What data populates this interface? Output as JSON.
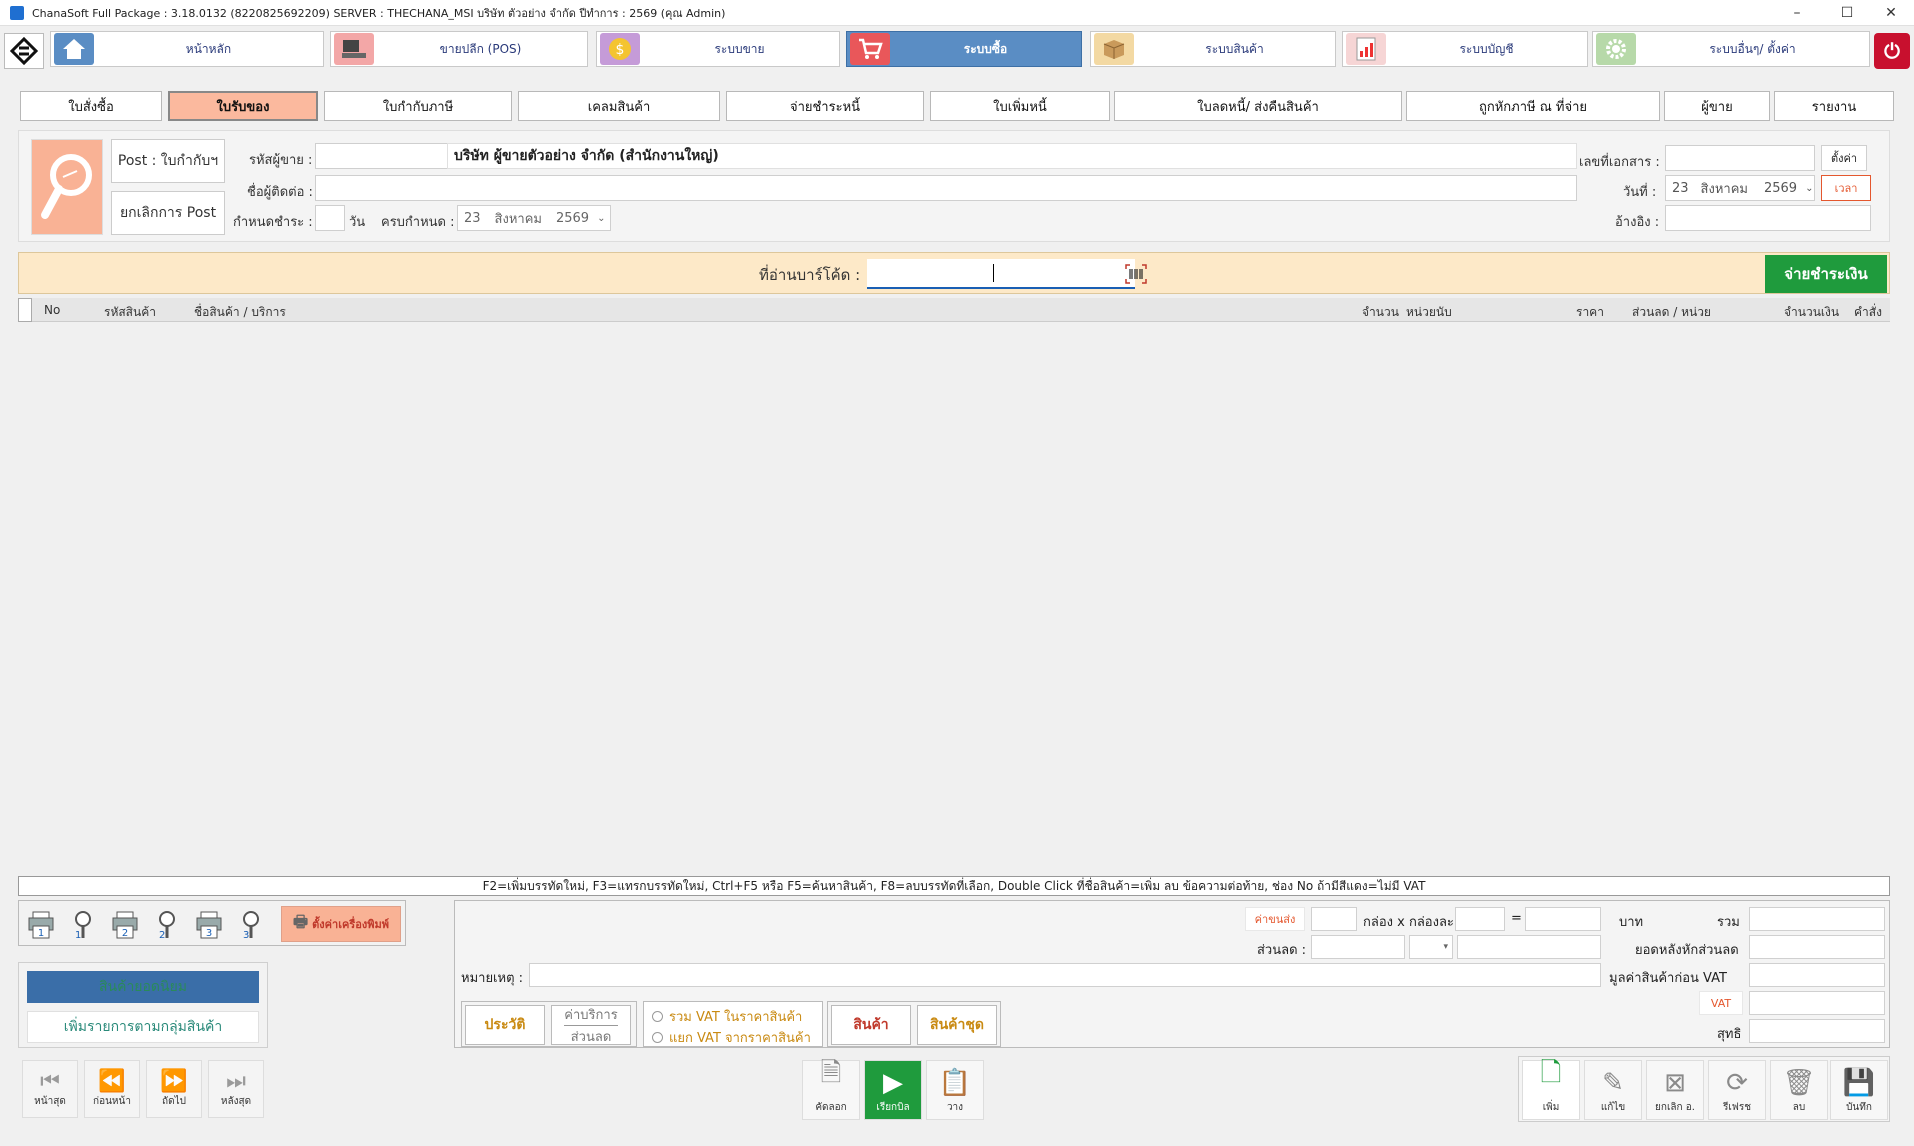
{
  "window": {
    "title": "ChanaSoft Full Package : 3.18.0132 (8220825692209) SERVER : THECHANA_MSI บริษัท ตัวอย่าง จำกัด ปีทำการ : 2569 (คุณ Admin)",
    "min_label": "–",
    "max_label": "☐",
    "close_label": "✕"
  },
  "menu": [
    {
      "label": "หน้าหลัก"
    },
    {
      "label": "ขายปลีก (POS)"
    },
    {
      "label": "ระบบขาย"
    },
    {
      "label": "ระบบซื้อ"
    },
    {
      "label": "ระบบสินค้า"
    },
    {
      "label": "ระบบบัญชี"
    },
    {
      "label": "ระบบอื่นๆ/ ตั้งค่า"
    }
  ],
  "tabs": [
    {
      "label": "ใบสั่งซื้อ"
    },
    {
      "label": "ใบรับของ"
    },
    {
      "label": "ใบกำกับภาษี"
    },
    {
      "label": "เคลมสินค้า"
    },
    {
      "label": "จ่ายชำระหนี้"
    },
    {
      "label": "ใบเพิ่มหนี้"
    },
    {
      "label": "ใบลดหนี้/ ส่งคืนสินค้า"
    },
    {
      "label": "ถูกหักภาษี ณ ที่จ่าย"
    },
    {
      "label": "ผู้ขาย"
    },
    {
      "label": "รายงาน"
    }
  ],
  "header": {
    "post_label": "Post : ใบกำกับฯ",
    "cancel_post_label": "ยกเลิกการ Post",
    "vendor_code_label": "รหัสผู้ขาย :",
    "vendor_name": "บริษัท ผู้ขายตัวอย่าง จำกัด (สำนักงานใหญ่)",
    "contact_label": "ชื่อผู้ติดต่อ :",
    "term_label": "กำหนดชำระ :",
    "days_label": "วัน",
    "due_label": "ครบกำหนด :",
    "due_day": "23",
    "due_month": "สิงหาคม",
    "due_year": "2569",
    "doc_no_label": "เลขที่เอกสาร :",
    "setting_btn": "ตั้งค่า",
    "date_label": "วันที่ :",
    "date_day": "23",
    "date_month": "สิงหาคม",
    "date_year": "2569",
    "time_btn": "เวลา",
    "ref_label": "อ้างอิง :"
  },
  "barcode": {
    "label": "ที่อ่านบาร์โค้ด :",
    "pay_btn": "จ่ายชำระเงิน"
  },
  "grid": {
    "columns": [
      "No",
      "รหัสสินค้า",
      "ชื่อสินค้า / บริการ",
      "จำนวน",
      "หน่วยนับ",
      "ราคา",
      "ส่วนลด / หน่วย",
      "จำนวนเงิน",
      "คำสั่ง"
    ]
  },
  "hint": "F2=เพิ่มบรรทัดใหม่,   F3=แทรกบรรทัดใหม่,   Ctrl+F5 หรือ F5=ค้นหาสินค้า,   F8=ลบบรรทัดที่เลือก,   Double Click ที่ชื่อสินค้า=เพิ่ม ลบ ข้อความต่อท้าย,   ช่อง No ถ้ามีสีแดง=ไม่มี VAT",
  "print": {
    "buttons": [
      "1",
      "1",
      "2",
      "2",
      "3",
      "3"
    ],
    "setup_label": "ตั้งค่าเครื่องพิมพ์"
  },
  "left_panel": {
    "popular_label": "สินค้ายอดนิยม",
    "group_label": "เพิ่มรายการตามกลุ่มสินค้า"
  },
  "nav": [
    {
      "label": "หน้าสุด",
      "icon": "⏮"
    },
    {
      "label": "ก่อนหน้า",
      "icon": "⏪"
    },
    {
      "label": "ถัดไป",
      "icon": "⏩"
    },
    {
      "label": "หลังสุด",
      "icon": "⏭"
    }
  ],
  "summary": {
    "shipping_label": "ค่าขนส่ง",
    "box_label": "กล่อง x กล่องละ",
    "equals": "=",
    "baht": "บาท",
    "discount_label": "ส่วนลด :",
    "note_label": "หมายเหตุ :",
    "total_label": "รวม",
    "after_discount_label": "ยอดหลังหักส่วนลด",
    "before_vat_label": "มูลค่าสินค้าก่อน VAT",
    "vat_label": "VAT",
    "net_label": "สุทธิ",
    "history_btn": "ประวัติ",
    "service_fee": "ค่าบริการ",
    "service_discount": "ส่วนลด",
    "vat_incl": "รวม VAT ในราคาสินค้า",
    "vat_excl": "แยก VAT จากราคาสินค้า",
    "product_btn": "สินค้า",
    "set_btn": "สินค้าชุด"
  },
  "center_actions": [
    {
      "label": "คัดลอก"
    },
    {
      "label": "เรียกบิล"
    },
    {
      "label": "วาง"
    }
  ],
  "right_actions": [
    {
      "label": "เพิ่ม"
    },
    {
      "label": "แก้ไข"
    },
    {
      "label": "ยกเลิก อ."
    },
    {
      "label": "รีเฟรช"
    },
    {
      "label": "ลบ"
    },
    {
      "label": "บันทึก"
    }
  ],
  "colors": {
    "accent_active_menu": "#5a8dc4",
    "active_tab": "#fbb99e",
    "pay_button": "#1f9b3d"
  }
}
